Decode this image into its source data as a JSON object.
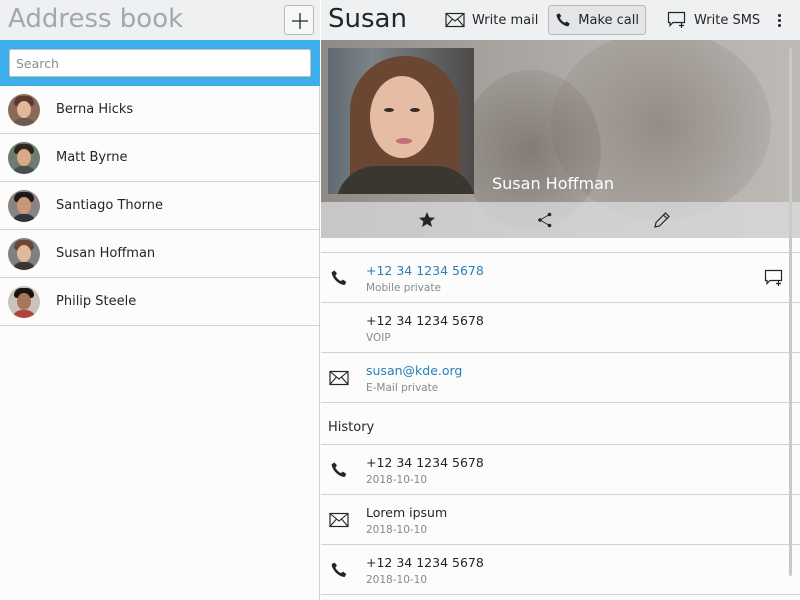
{
  "colors": {
    "accent": "#3daee9",
    "link": "#2980b9",
    "text": "#232629",
    "muted_title": "#a5a8ab",
    "secondary_text": "#7f8c8d",
    "header_bg": "#eff0f1"
  },
  "list_pane": {
    "title": "Address book",
    "add_icon": "plus-icon",
    "search": {
      "placeholder": "Search",
      "value": ""
    },
    "contacts": [
      {
        "name": "Berna Hicks",
        "avatar": "avatar-photo"
      },
      {
        "name": "Matt Byrne",
        "avatar": "avatar-photo"
      },
      {
        "name": "Santiago Thorne",
        "avatar": "avatar-photo"
      },
      {
        "name": "Susan Hoffman",
        "avatar": "avatar-photo"
      },
      {
        "name": "Philip Steele",
        "avatar": "avatar-photo"
      }
    ]
  },
  "detail_pane": {
    "title": "Susan",
    "toolbar": {
      "write_mail": {
        "label": "Write mail",
        "icon": "envelope-icon"
      },
      "make_call": {
        "label": "Make call",
        "icon": "phone-icon"
      },
      "write_sms": {
        "label": "Write SMS",
        "icon": "message-icon"
      },
      "menu_icon": "overflow-menu-icon"
    },
    "header": {
      "full_name": "Susan Hoffman",
      "actions": [
        "star-icon",
        "share-icon",
        "edit-icon"
      ]
    },
    "contact_info": [
      {
        "value": "+12 34 1234 5678",
        "label": "Mobile private",
        "icon": "phone-icon",
        "is_link": true,
        "has_sms_action": true
      },
      {
        "value": "+12 34 1234 5678",
        "label": "VOIP",
        "icon": "",
        "is_link": false,
        "has_sms_action": false
      },
      {
        "value": "susan@kde.org",
        "label": "E-Mail private",
        "icon": "envelope-icon",
        "is_link": true,
        "has_sms_action": false
      }
    ],
    "history": {
      "title": "History",
      "entries": [
        {
          "value": "+12 34 1234 5678",
          "date": "2018-10-10",
          "icon": "phone-icon"
        },
        {
          "value": "Lorem ipsum",
          "date": "2018-10-10",
          "icon": "envelope-icon"
        },
        {
          "value": "+12 34 1234 5678",
          "date": "2018-10-10",
          "icon": "phone-icon"
        }
      ]
    }
  }
}
